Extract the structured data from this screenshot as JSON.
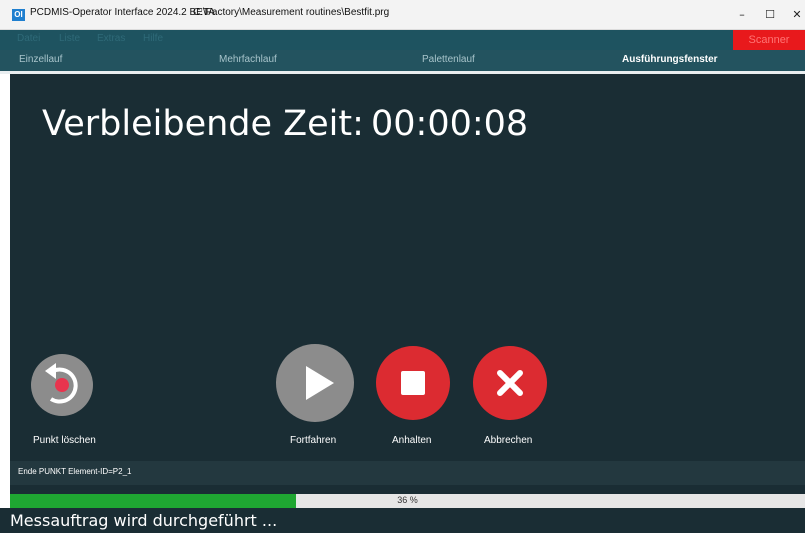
{
  "window": {
    "app_icon": "OI",
    "title": "PCDMIS-Operator Interface 2024.2 BETA",
    "path": "C:\\Factory\\Measurement routines\\Bestfit.prg",
    "minimize": "–",
    "maximize": "☐",
    "close": "✕"
  },
  "menu": {
    "items": [
      "Datei",
      "Liste",
      "Extras",
      "Hilfe"
    ],
    "scanner": "Scanner"
  },
  "tabs": [
    "Einzellauf",
    "Mehrfachlauf",
    "Palettenlauf",
    "Ausführungsfenster"
  ],
  "main": {
    "time_label": "Verbleibende Zeit:",
    "time_value": "00:00:08"
  },
  "buttons": {
    "delete_point": "Punkt löschen",
    "continue": "Fortfahren",
    "pause": "Anhalten",
    "cancel": "Abbrechen"
  },
  "status_line": "Ende PUNKT Element-ID=P2_1",
  "progress": {
    "percent": 36,
    "label": "36 %"
  },
  "bottom_status": "Messauftrag wird durchgeführt ...",
  "colors": {
    "main_bg": "#1a2d34",
    "scanner_red": "#e8191c",
    "progress_green": "#1fa632",
    "stop_red": "#dc2b31",
    "disabled_gray": "#8c8c8c"
  }
}
